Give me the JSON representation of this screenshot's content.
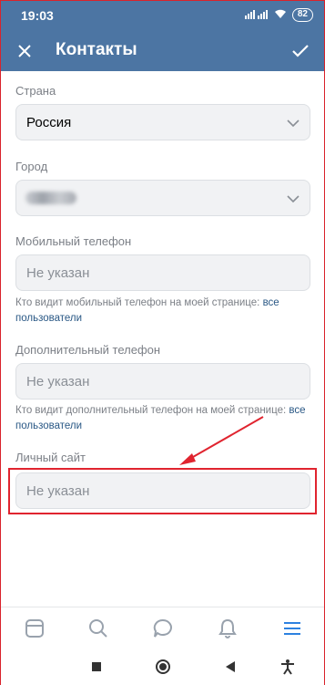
{
  "status": {
    "time": "19:03",
    "battery": "82"
  },
  "header": {
    "title": "Контакты"
  },
  "form": {
    "country": {
      "label": "Страна",
      "value": "Россия"
    },
    "city": {
      "label": "Город"
    },
    "mobile": {
      "label": "Мобильный телефон",
      "placeholder": "Не указан",
      "hint_text": "Кто видит мобильный телефон на моей странице: ",
      "hint_link": "все пользователи"
    },
    "extra": {
      "label": "Дополнительный телефон",
      "placeholder": "Не указан",
      "hint_text": "Кто видит дополнительный телефон на моей странице: ",
      "hint_link": "все пользователи"
    },
    "site": {
      "label": "Личный сайт",
      "placeholder": "Не указан"
    }
  },
  "colors": {
    "accent": "#4c75a3",
    "highlight": "#e0242f",
    "link": "#2a5885",
    "nav_active": "#2d81e0"
  },
  "bottom_nav": [
    "news-icon",
    "search-icon",
    "messages-icon",
    "notifications-icon",
    "menu-icon"
  ]
}
